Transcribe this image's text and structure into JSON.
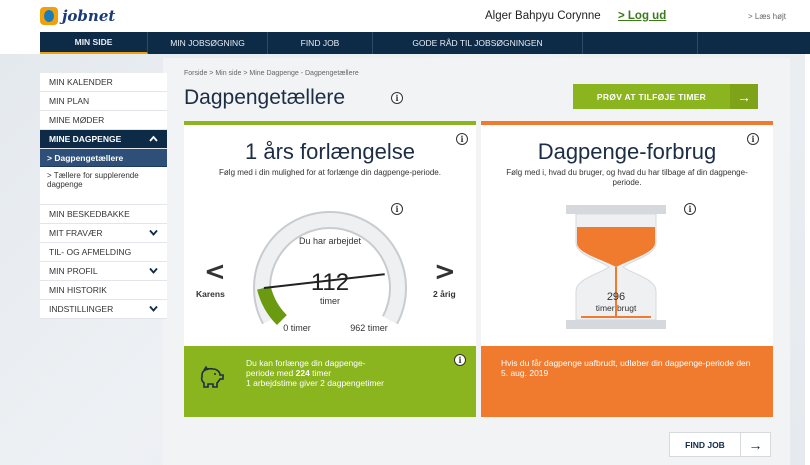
{
  "header": {
    "logo_text": "jobnet",
    "user_name": "Alger Bahpyu Corynne",
    "logout_label": "> Log ud",
    "read_aloud_label": "> Læs højt"
  },
  "nav": {
    "items": [
      {
        "label": "MIN SIDE",
        "active": true
      },
      {
        "label": "MIN JOBSØGNING"
      },
      {
        "label": "FIND JOB"
      },
      {
        "label": "GODE RÅD TIL JOBSØGNINGEN"
      },
      {
        "label": ""
      }
    ]
  },
  "sidebar": {
    "items": [
      {
        "label": "MIN KALENDER"
      },
      {
        "label": "MIN PLAN"
      },
      {
        "label": "MINE MØDER"
      },
      {
        "label": "MINE DAGPENGE",
        "chevron": "^"
      },
      {
        "label": "> Dagpengetællere"
      },
      {
        "label": "> Tællere for supplerende dagpenge"
      },
      {
        "label": "MIN BESKEDBAKKE"
      },
      {
        "label": "MIT FRAVÆR",
        "chevron": "v"
      },
      {
        "label": "TIL- OG AFMELDING"
      },
      {
        "label": "MIN PROFIL",
        "chevron": "v"
      },
      {
        "label": "MIN HISTORIK"
      },
      {
        "label": "INDSTILLINGER",
        "chevron": "v"
      }
    ]
  },
  "main": {
    "breadcrumb": "Forside > Min side > Mine Dagpenge - Dagpengetællere",
    "title": "Dagpengetællere",
    "cta_button": "PRØV AT TILFØJE TIMER",
    "find_job_button": "FIND JOB"
  },
  "left_panel": {
    "title": "1 års forlængelse",
    "description": "Følg med i din mulighed for at forlænge din dagpenge-periode.",
    "gauge_label": "Du har arbejdet",
    "gauge_value": "112",
    "gauge_unit": "timer",
    "gauge_min": "0 timer",
    "gauge_max": "962 timer",
    "gauge_fraction": 0.1164,
    "left_side": "Karens",
    "right_side": "2 årig",
    "bottom_line1_pre": "Du kan forlænge din dagpenge-",
    "bottom_line2_pre": "periode med ",
    "bottom_line2_bold": "224",
    "bottom_line2_post": " timer",
    "bottom_line3": "1 arbejdstime giver 2 dagpengetimer"
  },
  "right_panel": {
    "title": "Dagpenge-forbrug",
    "description": "Følg med i, hvad du bruger, og hvad du har tilbage af din dagpenge-periode.",
    "hourglass_value": "296",
    "hourglass_unit": "timer brugt",
    "bottom_text": "Hvis du får dagpenge uafbrudt, udløber din dagpenge-periode den 5. aug. 2019"
  },
  "colors": {
    "navy": "#0d2a46",
    "green": "#8bb51f",
    "orange": "#f07a2e"
  },
  "icons": {
    "info": "i",
    "arrow_right": "→",
    "chevron_left": "<",
    "chevron_right": ">"
  }
}
